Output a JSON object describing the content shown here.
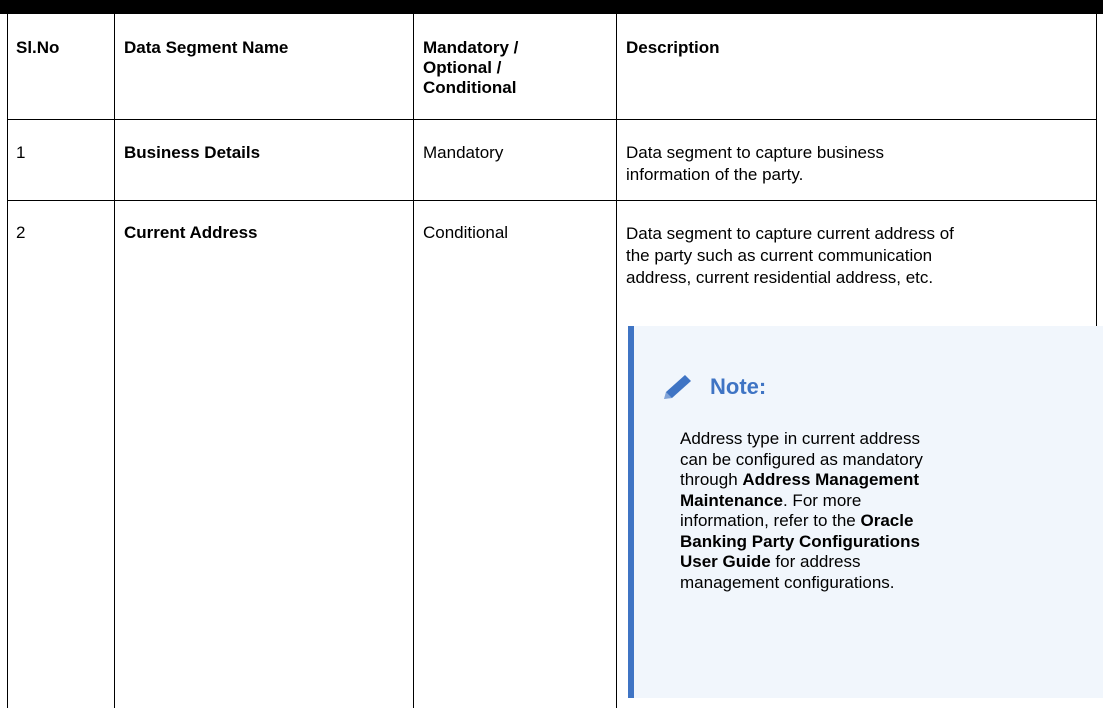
{
  "table": {
    "headers": {
      "slno": "Sl.No",
      "name": "Data Segment Name",
      "mandatory": [
        "Mandatory /",
        "Optional /",
        "Conditional"
      ],
      "description": "Description"
    },
    "rows": [
      {
        "slno": "1",
        "name": "Business Details",
        "mandatory": "Mandatory",
        "description": [
          "Data segment to capture business",
          "information of the party."
        ]
      },
      {
        "slno": "2",
        "name": "Current Address",
        "mandatory": "Conditional",
        "description": [
          "Data segment to capture current address of",
          "the party such as current communication",
          "address, current residential address, etc."
        ]
      }
    ]
  },
  "note": {
    "title": "Note:",
    "icon": "pencil-icon",
    "accent": "#3f74c4",
    "background": "#f1f6fc",
    "body": {
      "t1": "Address type in current address",
      "t2": "can be configured as mandatory",
      "t3": "through ",
      "b1": "Address Management",
      "b2": "Maintenance",
      "t4": ". For more",
      "t5": "information, refer to the ",
      "b3": "Oracle",
      "b4": "Banking Party Configurations",
      "b5": "User Guide",
      "t6": " for address",
      "t7": "management configurations."
    }
  }
}
